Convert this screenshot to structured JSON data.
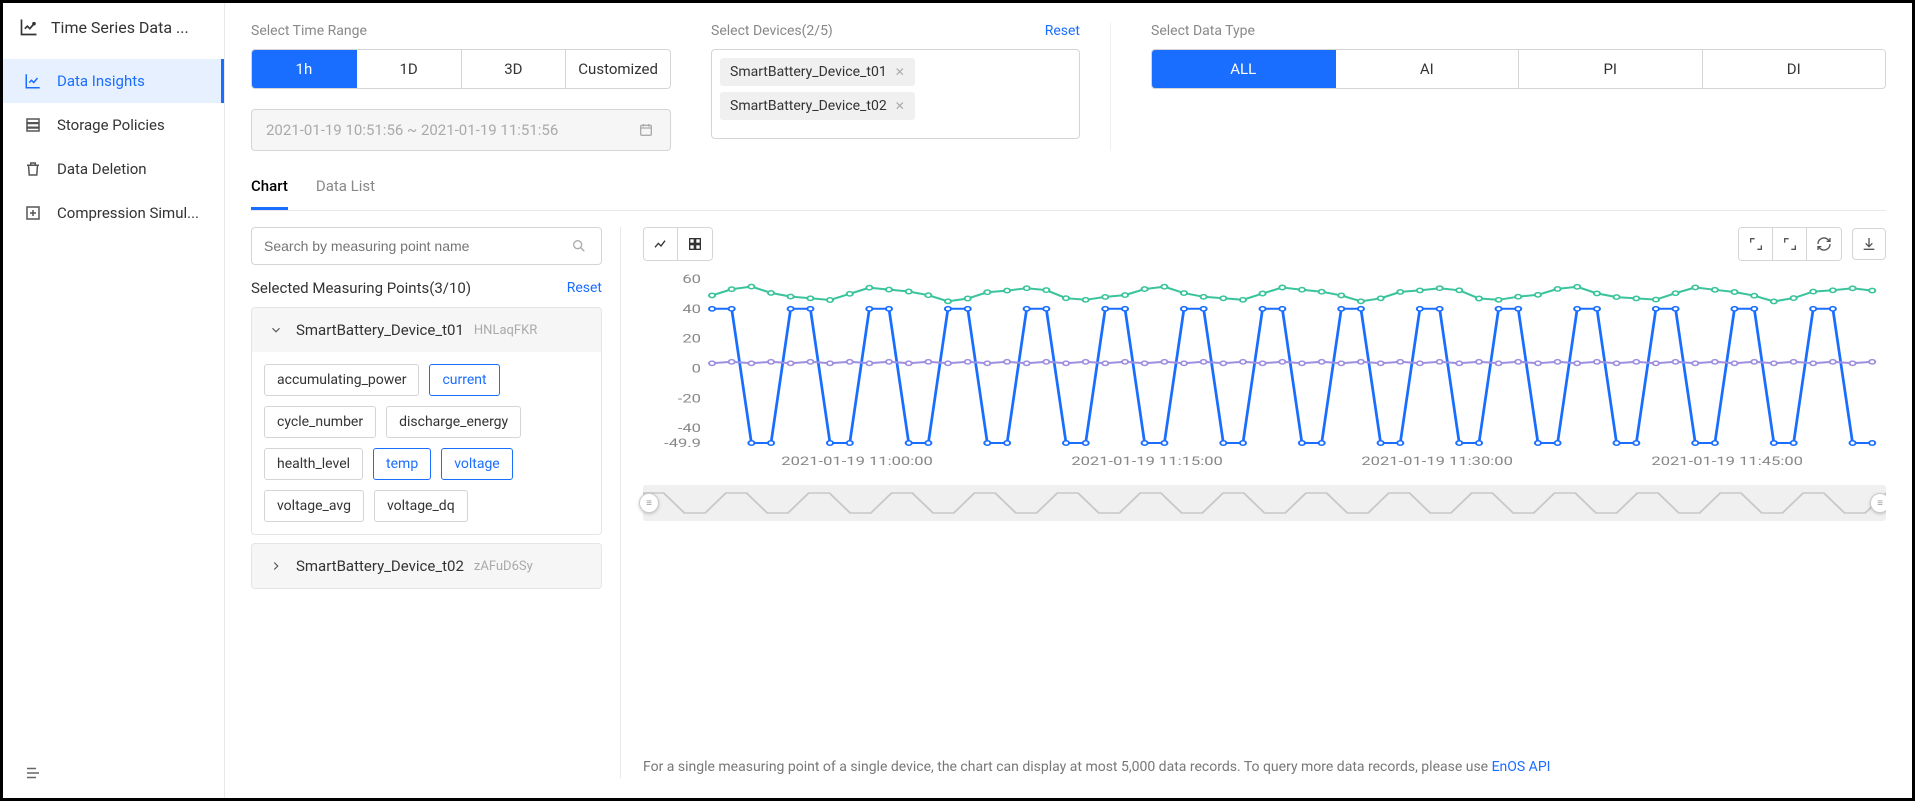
{
  "app_title": "Time Series Data ...",
  "sidebar": {
    "items": [
      {
        "label": "Data Insights"
      },
      {
        "label": "Storage Policies"
      },
      {
        "label": "Data Deletion"
      },
      {
        "label": "Compression Simul..."
      }
    ]
  },
  "filters": {
    "time_label": "Select Time Range",
    "ranges": [
      "1h",
      "1D",
      "3D",
      "Customized"
    ],
    "date_value": "2021-01-19 10:51:56 ~ 2021-01-19 11:51:56",
    "devices_label": "Select Devices(2/5)",
    "devices_reset": "Reset",
    "devices": [
      "SmartBattery_Device_t01",
      "SmartBattery_Device_t02"
    ],
    "type_label": "Select Data Type",
    "types": [
      "ALL",
      "AI",
      "PI",
      "DI"
    ]
  },
  "tabs": {
    "chart": "Chart",
    "list": "Data List"
  },
  "search_placeholder": "Search by measuring point name",
  "selected_label": "Selected Measuring Points(3/10)",
  "selected_reset": "Reset",
  "groups": [
    {
      "name": "SmartBattery_Device_t01",
      "sub": "HNLaqFKR",
      "open": true,
      "tags": [
        {
          "t": "accumulating_power",
          "s": false
        },
        {
          "t": "current",
          "s": true
        },
        {
          "t": "cycle_number",
          "s": false
        },
        {
          "t": "discharge_energy",
          "s": false
        },
        {
          "t": "health_level",
          "s": false
        },
        {
          "t": "temp",
          "s": true
        },
        {
          "t": "voltage",
          "s": true
        },
        {
          "t": "voltage_avg",
          "s": false
        },
        {
          "t": "voltage_dq",
          "s": false
        }
      ]
    },
    {
      "name": "SmartBattery_Device_t02",
      "sub": "zAFuD6Sy",
      "open": false,
      "tags": []
    }
  ],
  "note_text": "For a single measuring point of a single device, the chart can display at most 5,000 data records. To query more data records, please use ",
  "note_link": "EnOS API",
  "chart_data": {
    "type": "line",
    "ylim": [
      -49.9,
      60
    ],
    "yticks": [
      -49.9,
      -40,
      -20,
      0,
      20,
      40,
      60
    ],
    "xticks": [
      "2021-01-19 11:00:00",
      "2021-01-19 11:15:00",
      "2021-01-19 11:30:00",
      "2021-01-19 11:45:00"
    ],
    "n_points": 60,
    "series": [
      {
        "name": "temp",
        "color": "#3bc49b",
        "pattern": "wave",
        "base": 50,
        "amp": 4
      },
      {
        "name": "current",
        "color": "#1a6eff",
        "pattern": "triangle",
        "low": -49.9,
        "high": 40,
        "period": 4
      },
      {
        "name": "voltage",
        "color": "#9f8fe0",
        "pattern": "flat",
        "base": 4,
        "amp": 1
      }
    ]
  }
}
